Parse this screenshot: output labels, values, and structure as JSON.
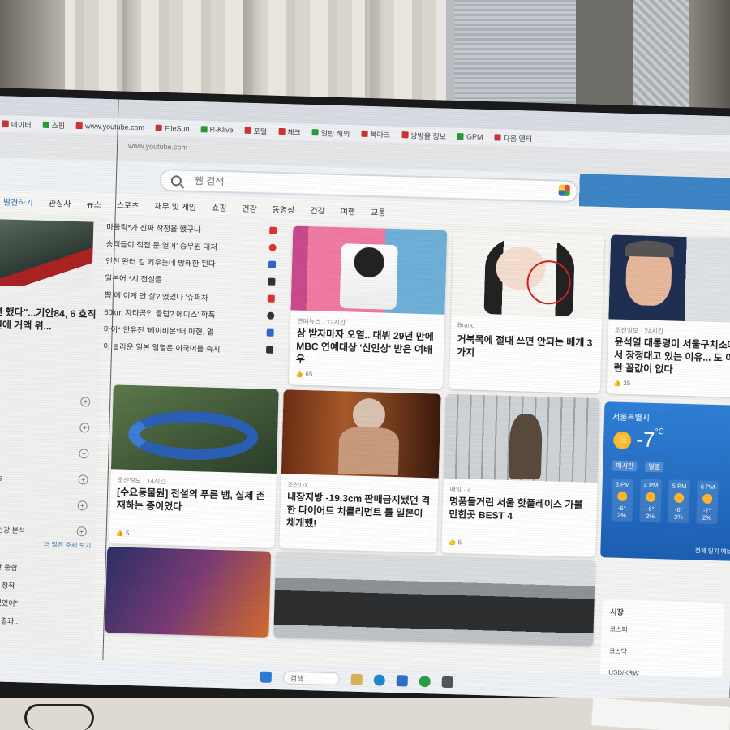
{
  "browser": {
    "bookmarks": [
      "네이버",
      "쇼핑",
      "www.youtube.com",
      "FileSun",
      "R-Klive",
      "포털",
      "체크",
      "일반 해외",
      "북마크",
      "쌍방울 정보",
      "GPM",
      "다음 엔터"
    ],
    "address": "www.youtube.com",
    "search_placeholder": "웹 검색"
  },
  "categories": [
    "발견하기",
    "관심사",
    "뉴스",
    "스포츠",
    "재무 및 게임",
    "쇼핑",
    "건강",
    "동영상",
    "건강",
    "여행",
    "교통"
  ],
  "left_column": {
    "lead_title": "편 했다\"...기안84, 6 호직원에 거액 위...",
    "side_items": [
      "목",
      "",
      "니",
      "리능",
      "",
      "실 건강 분석"
    ],
    "more_link": "더 많은 주제 보기",
    "bottom_items": [
      "인 상 종합",
      "전쟁 정착",
      "\"버텼었어\"",
      "다룬 결과..."
    ]
  },
  "headlines": [
    "마들릭*가 진짜 작정을 했구나",
    "승객들이 직접 문 열어' 승무원 대처",
    "인천 완터 김 키우는데 방해한 된다",
    "일본어 *시 전실들",
    "뽑 에 이게 안 살? 였었나 '슈퍼차",
    "60km 자타공인 클럽? 에이스' 학폭",
    "마이* 안유진 '베이비몬*터 아현, 열",
    "이 놀라운 일본 일열은 이국어를 죽시"
  ],
  "cards": [
    {
      "source": "연예뉴스 · 12시간",
      "title": "상 받자마자 오열.. 대뷔 29년 만에 MBC 연예대상 '신인상' 받은 여배우",
      "reactions": "65"
    },
    {
      "source": "Brand",
      "title": "거북목에 절대 쓰면 안되는 베개 3가지",
      "reactions": ""
    },
    {
      "source": "조선일보 · 24시간",
      "title": "윤석열 대통령이 서울구치소에서 장정대고 있는 이유... 도 이런 꼴값이 없다",
      "reactions": "35"
    },
    {
      "source": "조선일보 · 14시간",
      "title": "[수요동물원] 전설의 푸른 뱀, 실제 존재하는 종이었다",
      "reactions": "5"
    },
    {
      "source": "조선DX",
      "title": "내장지방 -19.3cm 판매금지됐던 격한 다이어트 치를리먼트 를 일본이 채개했!",
      "reactions": ""
    },
    {
      "source": "매일 · 4",
      "title": "명품들거린 서울 핫플레이스 가볼만한곳 BEST 4",
      "reactions": "5"
    }
  ],
  "weather": {
    "location": "서울특별시",
    "temperature": "-7",
    "unit": "°C",
    "tabs": [
      "매시간",
      "일별"
    ],
    "hours": [
      {
        "time": "3 PM",
        "temp": "-6°",
        "rain": "2%"
      },
      {
        "time": "4 PM",
        "temp": "-6°",
        "rain": "2%"
      },
      {
        "time": "5 PM",
        "temp": "-6°",
        "rain": "3%"
      },
      {
        "time": "6 PM",
        "temp": "-7°",
        "rain": "2%"
      }
    ],
    "more": "전체 일기 예보"
  },
  "stocks": {
    "title": "시장",
    "items": [
      "코스피",
      "코스닥",
      "USD/KRW"
    ]
  },
  "taskbar": {
    "search_label": "검색"
  }
}
